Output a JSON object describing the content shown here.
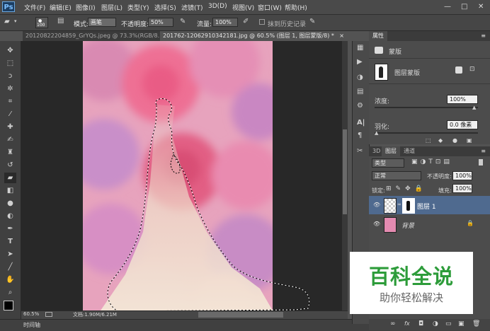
{
  "app": {
    "logo": "Ps"
  },
  "menu": [
    "文件(F)",
    "编辑(E)",
    "图像(I)",
    "图层(L)",
    "类型(Y)",
    "选择(S)",
    "滤镜(T)",
    "3D(D)",
    "视图(V)",
    "窗口(W)",
    "帮助(H)"
  ],
  "window_controls": [
    "—",
    "□",
    "✕"
  ],
  "options": {
    "brush_size": "100",
    "mode_label": "模式:",
    "mode_value": "画笔",
    "opacity_label": "不透明度:",
    "opacity_value": "50%",
    "flow_label": "流量:",
    "flow_value": "100%",
    "history_label": "抹到历史记录"
  },
  "tabs": [
    {
      "label": "20120822204859_GrYQs.jpeg @ 73.3%(RGB/8...",
      "close": "×"
    },
    {
      "label": "201762-12062910342181.jpg @ 60.5% (图层 1, 图层蒙版/8) *",
      "close": "×"
    }
  ],
  "status": {
    "zoom": "60.5%",
    "doc": "文档:1.90M/6.21M",
    "timeline": "时间轴"
  },
  "properties": {
    "title": "属性",
    "mask_heading": "蒙版",
    "mask_type": "图层蒙版",
    "density_label": "浓度:",
    "density_value": "100%",
    "feather_label": "羽化:",
    "feather_value": "0.0 像素"
  },
  "layers_panel": {
    "tabs": [
      "3D",
      "图层",
      "通道"
    ],
    "kind": "类型",
    "blend": "正常",
    "opacity_label": "不透明度:",
    "opacity_value": "100%",
    "lock_label": "锁定:",
    "fill_label": "填充:",
    "fill_value": "100%",
    "layers": [
      {
        "name": "图层 1",
        "selected": true
      },
      {
        "name": "背景",
        "selected": false
      }
    ],
    "footer_icons": [
      "link-icon",
      "fx-icon",
      "mask-icon",
      "adjust-icon",
      "folder-icon",
      "new-layer-icon",
      "trash-icon"
    ]
  },
  "watermark": {
    "title": "百科全说",
    "subtitle": "助你轻松解决"
  },
  "colors": {
    "accent_blue": "#6aa7de",
    "selected_layer": "#4f6a8f",
    "watermark_green": "#2d9c3a"
  }
}
